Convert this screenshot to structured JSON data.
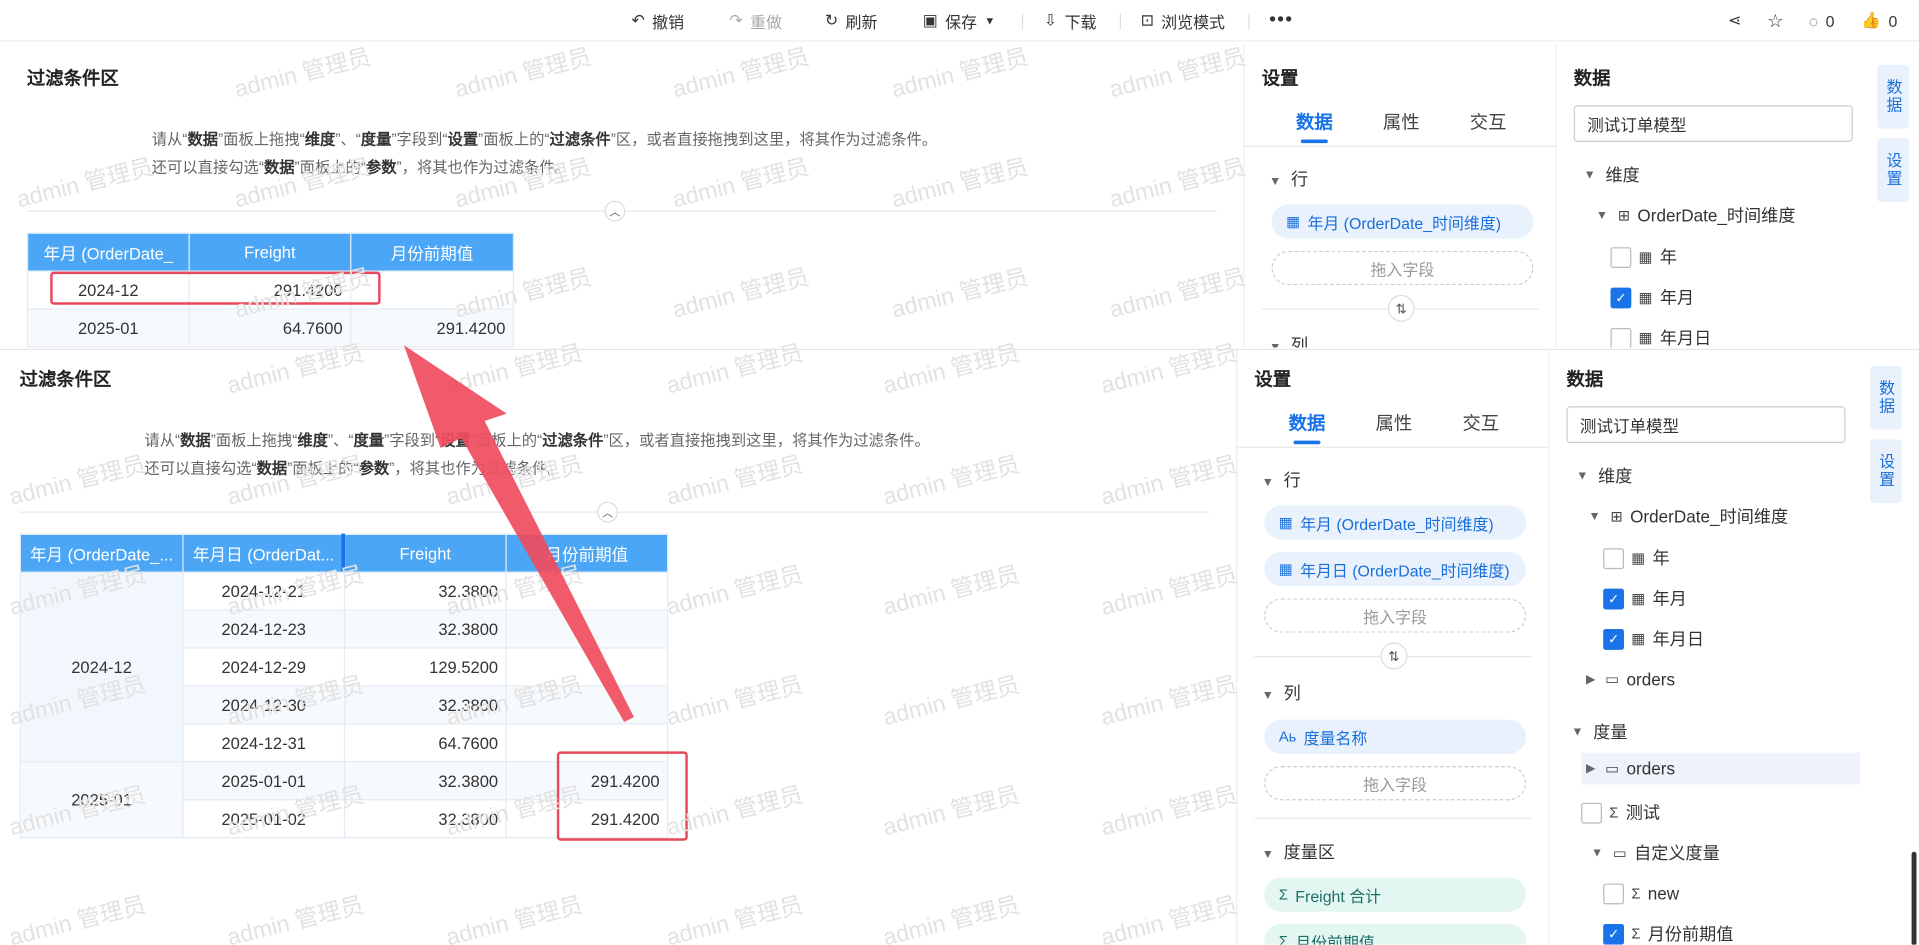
{
  "toolbar": {
    "undo": "撤销",
    "redo": "重做",
    "refresh": "刷新",
    "save": "保存",
    "download": "下载",
    "browse": "浏览模式",
    "comment_count": "0",
    "like_count": "0"
  },
  "watermark": "admin 管理员",
  "colors": {
    "accent": "#1a73e8",
    "table_header": "#4ba6f5",
    "highlight_box": "#e9495a",
    "arrow": "#ef4c5d"
  },
  "top": {
    "filter_title": "过滤条件区",
    "desc_line1": {
      "a": "请从“",
      "b": "数据",
      "c": "”面板上拖拽“",
      "d": "维度",
      "e": "”、“",
      "f": "度量",
      "g": "”字段到“",
      "h": "设置",
      "i": "”面板上的“",
      "j": "过滤条件",
      "k": "”区，或者直接拖拽到这里，将其作为过滤条件。"
    },
    "desc_line2": {
      "a": "还可以直接勾选“",
      "b": "数据",
      "c": "”面板上的“",
      "d": "参数",
      "e": "”，将其也作为过滤条件。"
    },
    "table": {
      "headers": [
        "年月 (OrderDate_",
        "Freight",
        "月份前期值"
      ],
      "rows": [
        [
          "2024-12",
          "291.4200",
          ""
        ],
        [
          "2025-01",
          "64.7600",
          "291.4200"
        ]
      ]
    },
    "settings": {
      "title": "设置",
      "tabs": [
        "数据",
        "属性",
        "交互"
      ],
      "row_section": "行",
      "row_fields": [
        "年月 (OrderDate_时间维度)"
      ],
      "drop_hint": "拖入字段",
      "col_section": "列"
    },
    "data": {
      "title": "数据",
      "model": "测试订单模型",
      "dimension": "维度",
      "time_dim": "OrderDate_时间维度",
      "items": [
        {
          "label": "年",
          "checked": false
        },
        {
          "label": "年月",
          "checked": true
        },
        {
          "label": "年月日",
          "checked": false
        }
      ]
    },
    "sidetabs": [
      "数据",
      "设置"
    ]
  },
  "bottom": {
    "filter_title": "过滤条件区",
    "table": {
      "headers": [
        "年月 (OrderDate_...",
        "年月日 (OrderDat...",
        "Freight",
        "月份前期值"
      ],
      "groups": [
        {
          "label": "2024-12",
          "rows": [
            [
              "2024-12-21",
              "32.3800",
              ""
            ],
            [
              "2024-12-23",
              "32.3800",
              ""
            ],
            [
              "2024-12-29",
              "129.5200",
              ""
            ],
            [
              "2024-12-30",
              "32.3800",
              ""
            ],
            [
              "2024-12-31",
              "64.7600",
              ""
            ]
          ]
        },
        {
          "label": "2025-01",
          "rows": [
            [
              "2025-01-01",
              "32.3800",
              "291.4200"
            ],
            [
              "2025-01-02",
              "32.3800",
              "291.4200"
            ]
          ]
        }
      ]
    },
    "settings": {
      "title": "设置",
      "tabs": [
        "数据",
        "属性",
        "交互"
      ],
      "row_section": "行",
      "row_fields": [
        "年月 (OrderDate_时间维度)",
        "年月日 (OrderDate_时间维度)"
      ],
      "drop_hint": "拖入字段",
      "col_section": "列",
      "col_fields": [
        "度量名称"
      ],
      "measure_section": "度量区",
      "measure_fields": [
        "Freight 合计",
        "月份前期值"
      ]
    },
    "data": {
      "title": "数据",
      "model": "测试订单模型",
      "dimension": "维度",
      "time_dim": "OrderDate_时间维度",
      "items": [
        {
          "label": "年",
          "checked": false
        },
        {
          "label": "年月",
          "checked": true
        },
        {
          "label": "年月日",
          "checked": true
        }
      ],
      "orders_folder": "orders",
      "measure": "度量",
      "measure_orders": "orders",
      "test": "测试",
      "custom_measure": "自定义度量",
      "custom_items": [
        {
          "label": "new",
          "checked": false
        },
        {
          "label": "月份前期值",
          "checked": true
        }
      ]
    },
    "sidetabs": [
      "数据",
      "设置"
    ]
  }
}
